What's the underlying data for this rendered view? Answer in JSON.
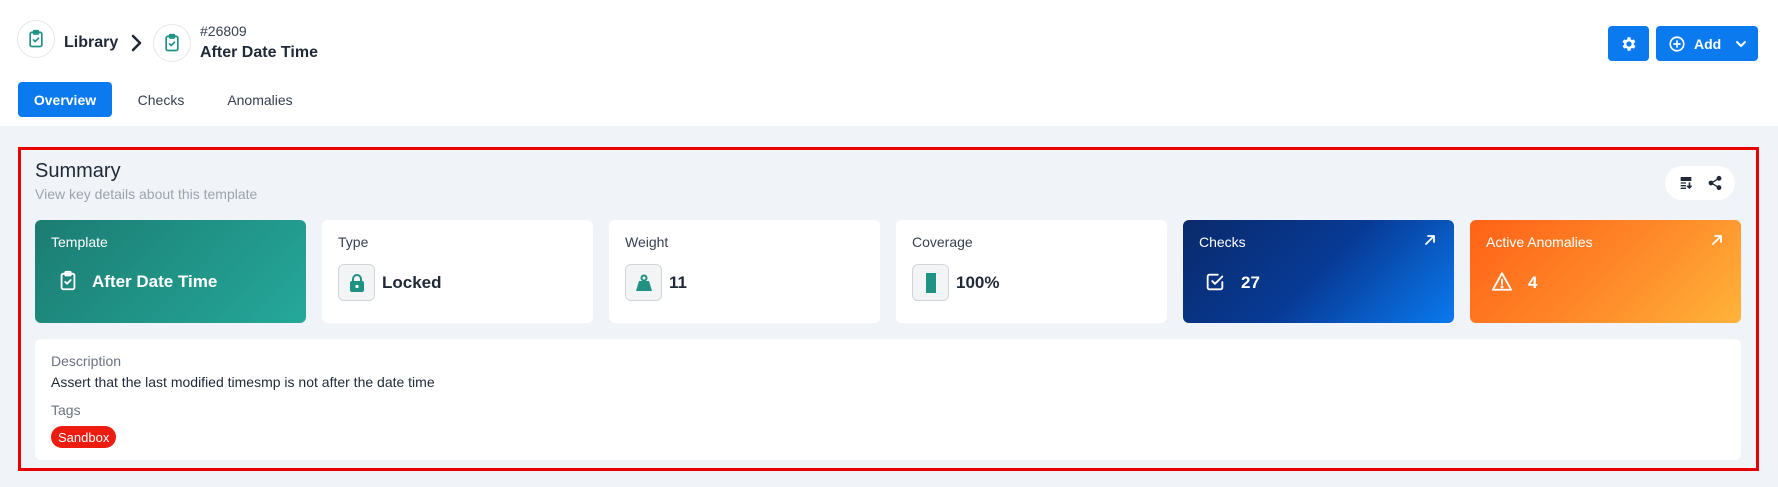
{
  "breadcrumb": {
    "root_label": "Library",
    "template_id": "#26809",
    "template_title": "After Date Time"
  },
  "actions": {
    "settings_icon": "gear-icon",
    "add_label": "Add"
  },
  "tabs": [
    {
      "label": "Overview",
      "active": true
    },
    {
      "label": "Checks",
      "active": false
    },
    {
      "label": "Anomalies",
      "active": false
    }
  ],
  "summary": {
    "title": "Summary",
    "subtitle": "View key details about this template",
    "cards": {
      "template": {
        "label": "Template",
        "value": "After Date Time"
      },
      "type": {
        "label": "Type",
        "value": "Locked"
      },
      "weight": {
        "label": "Weight",
        "value": "11"
      },
      "coverage": {
        "label": "Coverage",
        "value": "100%"
      },
      "checks": {
        "label": "Checks",
        "value": "27"
      },
      "anomalies": {
        "label": "Active Anomalies",
        "value": "4"
      }
    },
    "description_label": "Description",
    "description": "Assert that the last modified timesmp is not after the date time",
    "tags_label": "Tags",
    "tags": [
      "Sandbox"
    ]
  },
  "colors": {
    "accent": "#0a7aee",
    "teal": "#1f9283",
    "tag_red": "#ec1d10",
    "highlight_frame": "#e60000"
  }
}
